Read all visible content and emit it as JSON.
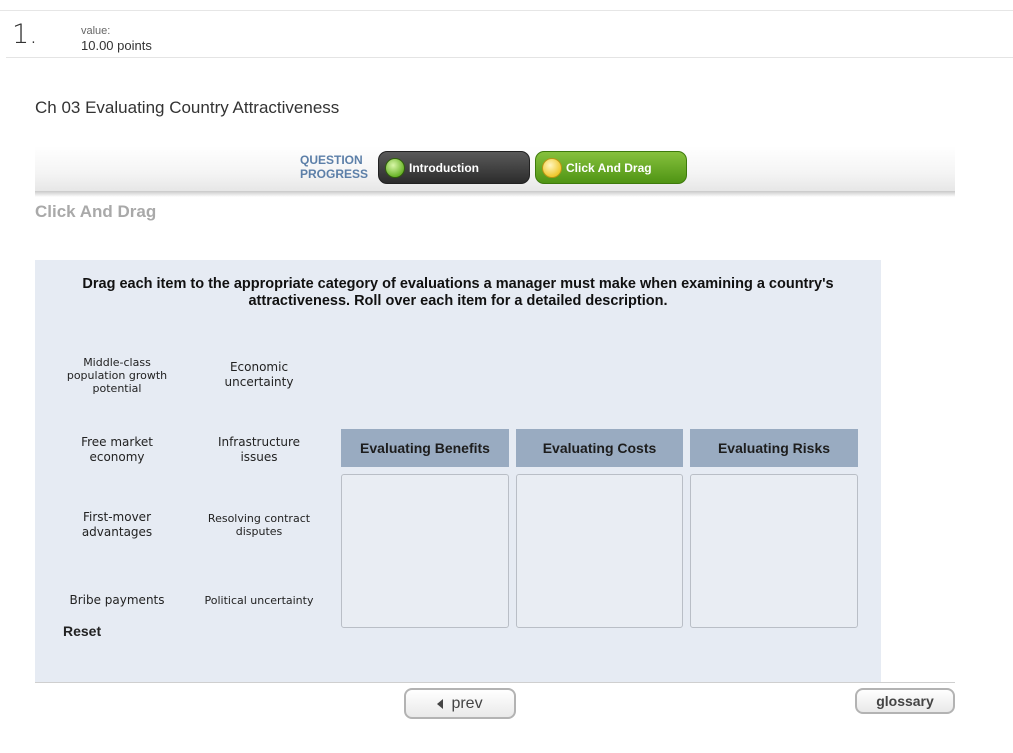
{
  "question": {
    "number": "1.",
    "value_label": "value:",
    "value_points": "10.00 points",
    "title": "Ch 03 Evaluating Country Attractiveness"
  },
  "progress": {
    "label_line1": "QUESTION",
    "label_line2": "PROGRESS",
    "steps": [
      {
        "label": "Introduction",
        "icon": "green-dot-icon",
        "color": "#3a3a3a"
      },
      {
        "label": "Click And Drag",
        "icon": "yellow-dot-icon",
        "color": "#5fa51f"
      }
    ]
  },
  "section_title": "Click And Drag",
  "instructions": "Drag each item to the appropriate category of evaluations a manager must make when examining a country's attractiveness. Roll over each item for a detailed description.",
  "items": [
    "Middle-class population growth potential",
    "Economic uncertainty",
    "Free market economy",
    "Infrastructure issues",
    "First-mover advantages",
    "Resolving contract disputes",
    "Bribe payments",
    "Political uncertainty"
  ],
  "categories": [
    "Evaluating Benefits",
    "Evaluating Costs",
    "Evaluating Risks"
  ],
  "reset_label": "Reset",
  "nav": {
    "prev_label": "prev",
    "glossary_label": "glossary"
  },
  "colors": {
    "panel_bg": "#e6ebf3",
    "category_header": "#99abc1",
    "progress_label": "#5c7fa8"
  }
}
